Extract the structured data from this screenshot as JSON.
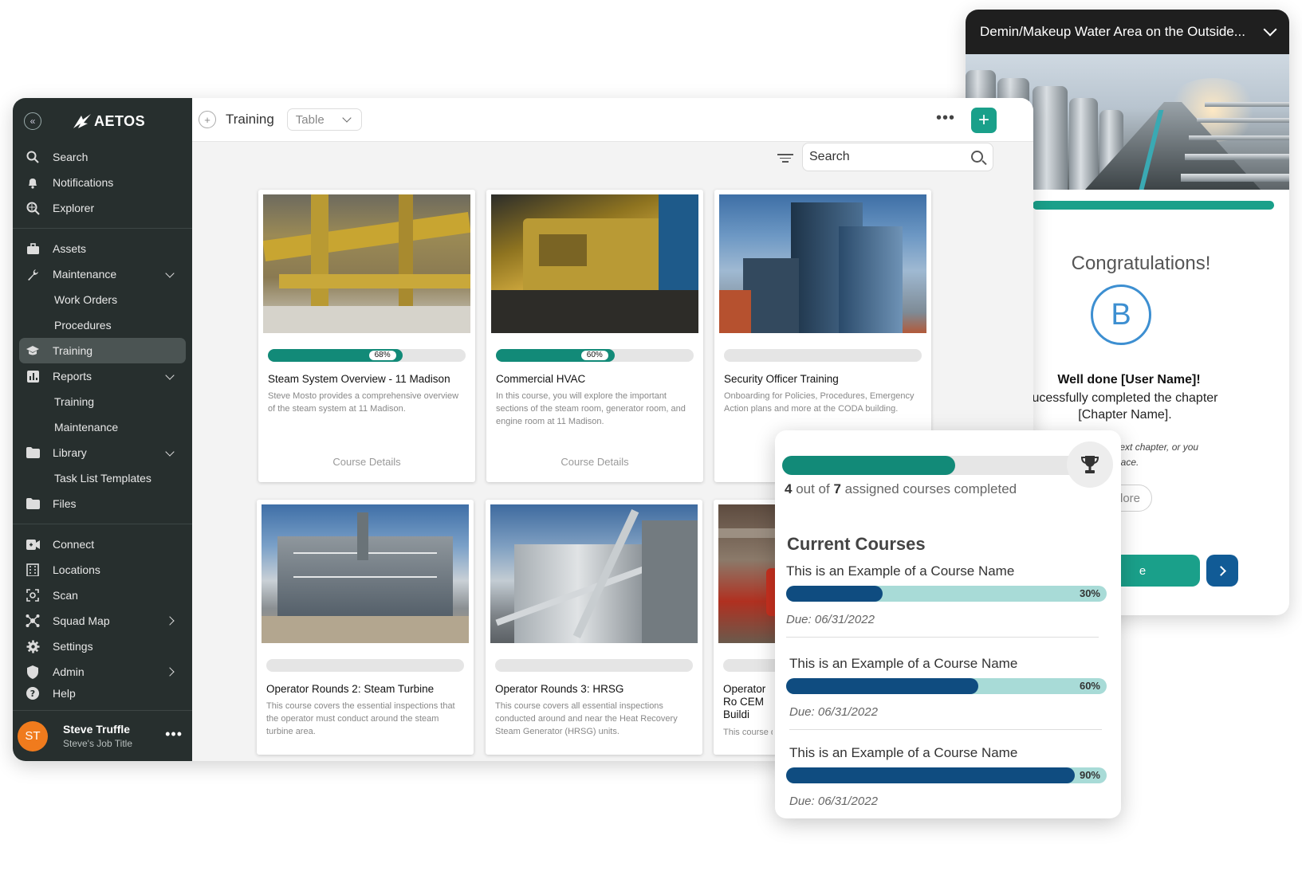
{
  "location_panel": {
    "location_select": "Demin/Makeup Water Area on the Outside...",
    "congrats_title": "Congratulations!",
    "badge_letter": "B",
    "well_done": "Well done [User Name]!",
    "chapter_line1": "ucessfully completed the chapter",
    "chapter_line2": "[Chapter Name].",
    "next_note_1": "he next chapter, or you",
    "next_note_2": "is space.",
    "explore_label": "plore",
    "continue_label": "e"
  },
  "sidebar": {
    "brand": "AETOS",
    "items": [
      {
        "label": "Search",
        "icon": "search-icon"
      },
      {
        "label": "Notifications",
        "icon": "bell-icon"
      },
      {
        "label": "Explorer",
        "icon": "explorer-icon"
      },
      {
        "label": "Assets",
        "icon": "briefcase-icon"
      },
      {
        "label": "Maintenance",
        "icon": "wrench-icon"
      },
      {
        "label": "Work Orders"
      },
      {
        "label": "Procedures"
      },
      {
        "label": "Training",
        "icon": "graduation-cap-icon"
      },
      {
        "label": "Reports",
        "icon": "bar-chart-icon"
      },
      {
        "label": "Training"
      },
      {
        "label": "Maintenance"
      },
      {
        "label": "Library",
        "icon": "folder-icon"
      },
      {
        "label": "Task List Templates"
      },
      {
        "label": "Files",
        "icon": "folder-icon"
      },
      {
        "label": "Connect",
        "icon": "video-icon"
      },
      {
        "label": "Locations",
        "icon": "building-icon"
      },
      {
        "label": "Scan",
        "icon": "scan-icon"
      },
      {
        "label": "Squad Map",
        "icon": "network-icon"
      },
      {
        "label": "Settings",
        "icon": "gear-icon"
      },
      {
        "label": "Admin",
        "icon": "shield-icon"
      },
      {
        "label": "Help",
        "icon": "help-icon"
      }
    ],
    "user": {
      "initials": "ST",
      "name": "Steve Truffle",
      "job_title": "Steve's Job Title"
    }
  },
  "toolbar": {
    "title": "Training",
    "view": "Table",
    "search_placeholder": "Search"
  },
  "courses": [
    {
      "title": "Steam System Overview - 11 Madison",
      "progress": 68,
      "progress_label": "68%",
      "description": "Steve Mosto provides a comprehensive overview of the steam system at 11 Madison.",
      "details": "Course Details"
    },
    {
      "title": "Commercial HVAC",
      "progress": 60,
      "progress_label": "60%",
      "description": "In this course, you will explore the important sections of the steam room, generator room, and engine room at 11 Madison.",
      "details": "Course Details"
    },
    {
      "title": "Security Officer Training",
      "progress": 0,
      "progress_label": "",
      "description": "Onboarding for Policies, Procedures, Emergency Action plans and more at the CODA building.",
      "details": ""
    },
    {
      "title": "Operator Rounds 2: Steam Turbine",
      "progress": 0,
      "progress_label": "",
      "description": "This course covers the essential inspections that the operator must conduct around the steam turbine area.",
      "details": ""
    },
    {
      "title": "Operator Rounds 3: HRSG",
      "progress": 0,
      "progress_label": "",
      "description": "This course covers all essential inspections conducted around and near the Heat Recovery Steam Generator (HRSG) units.",
      "details": ""
    },
    {
      "title": "Operator Ro CEM Buildi",
      "progress": 0,
      "progress_label": "",
      "description": "This course d required aro",
      "details": ""
    }
  ],
  "course_panel": {
    "completed": "4",
    "summary_mid": " out of ",
    "assigned": "7",
    "summary_end": " assigned courses completed",
    "completion_fraction": 0.57,
    "heading": "Current Courses",
    "items": [
      {
        "name": "This is an Example of a Course Name",
        "progress": 30,
        "label": "30%",
        "due": "Due: 06/31/2022"
      },
      {
        "name": "This is an Example of a Course Name",
        "progress": 60,
        "label": "60%",
        "due": "Due: 06/31/2022"
      },
      {
        "name": "This is an Example of a Course Name",
        "progress": 90,
        "label": "90%",
        "due": "Due: 06/31/2022"
      }
    ]
  },
  "colors": {
    "teal": "#128a78",
    "navy": "#0f4c80",
    "sidebar": "#272f2e",
    "avatar": "#f07b1d",
    "badge": "#3d8fd1"
  }
}
